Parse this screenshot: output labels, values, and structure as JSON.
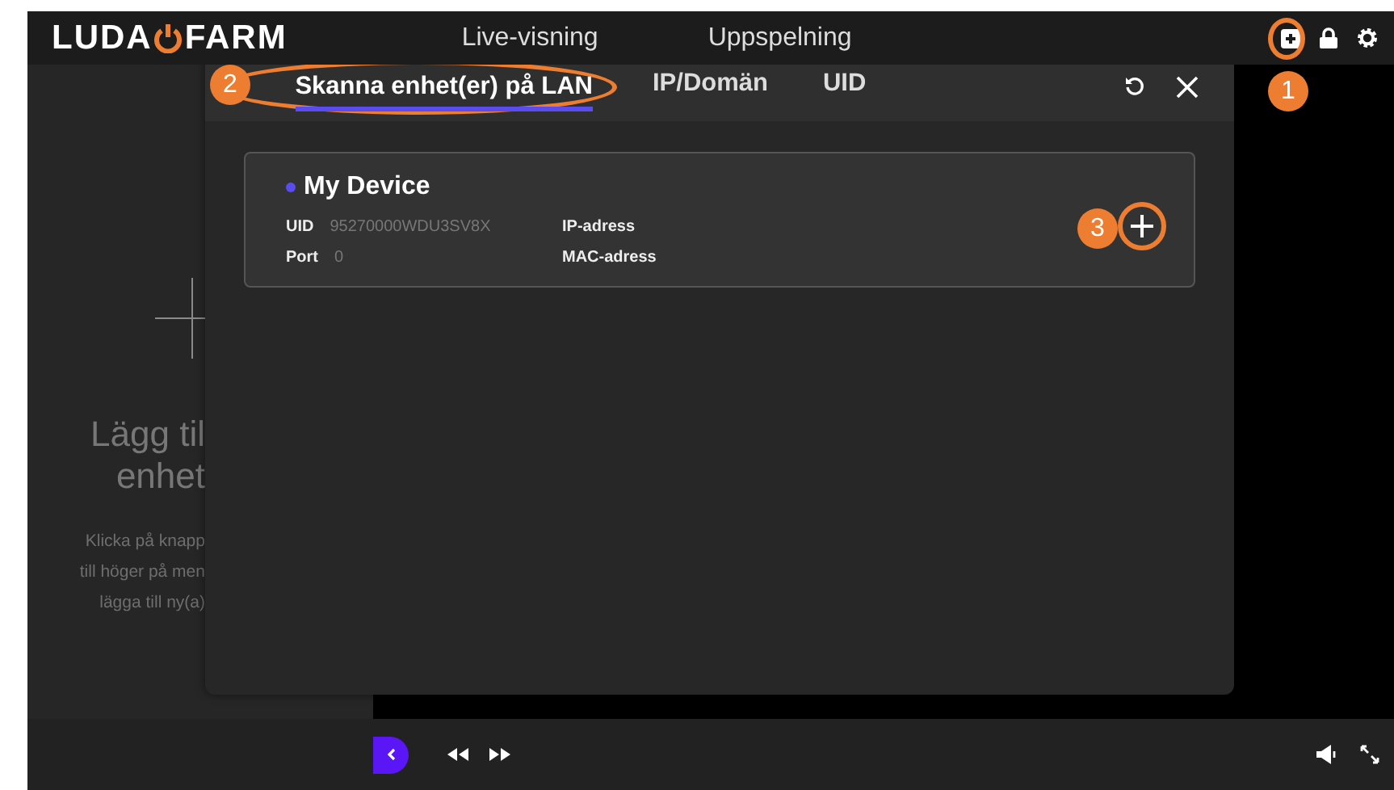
{
  "header": {
    "logo": {
      "left": "LUDA",
      "right": "FARM"
    },
    "nav": [
      {
        "label": "Live-visning",
        "selected": false
      },
      {
        "label": "Uppspelning",
        "selected": false
      }
    ]
  },
  "empty_state": {
    "title_lines": [
      "Lägg til",
      "enhet"
    ],
    "hint_lines": [
      "Klicka på knapp",
      "till höger på men",
      "lägga till ny(a)"
    ]
  },
  "dialog": {
    "tabs": [
      {
        "label": "Skanna enhet(er) på LAN",
        "selected": true
      },
      {
        "label": "IP/Domän",
        "selected": false
      },
      {
        "label": "UID",
        "selected": false
      }
    ],
    "devices": [
      {
        "name": "My Device",
        "color": "#5b4cf0",
        "fields": [
          {
            "label": "UID",
            "value": "95270000WDU3SV8X"
          },
          {
            "label": "IP-adress"
          },
          {
            "label": "Port",
            "value": "0"
          },
          {
            "label": "MAC-adress"
          }
        ]
      }
    ]
  },
  "callouts": [
    {
      "label": "1"
    },
    {
      "label": "2"
    },
    {
      "label": "3"
    }
  ]
}
